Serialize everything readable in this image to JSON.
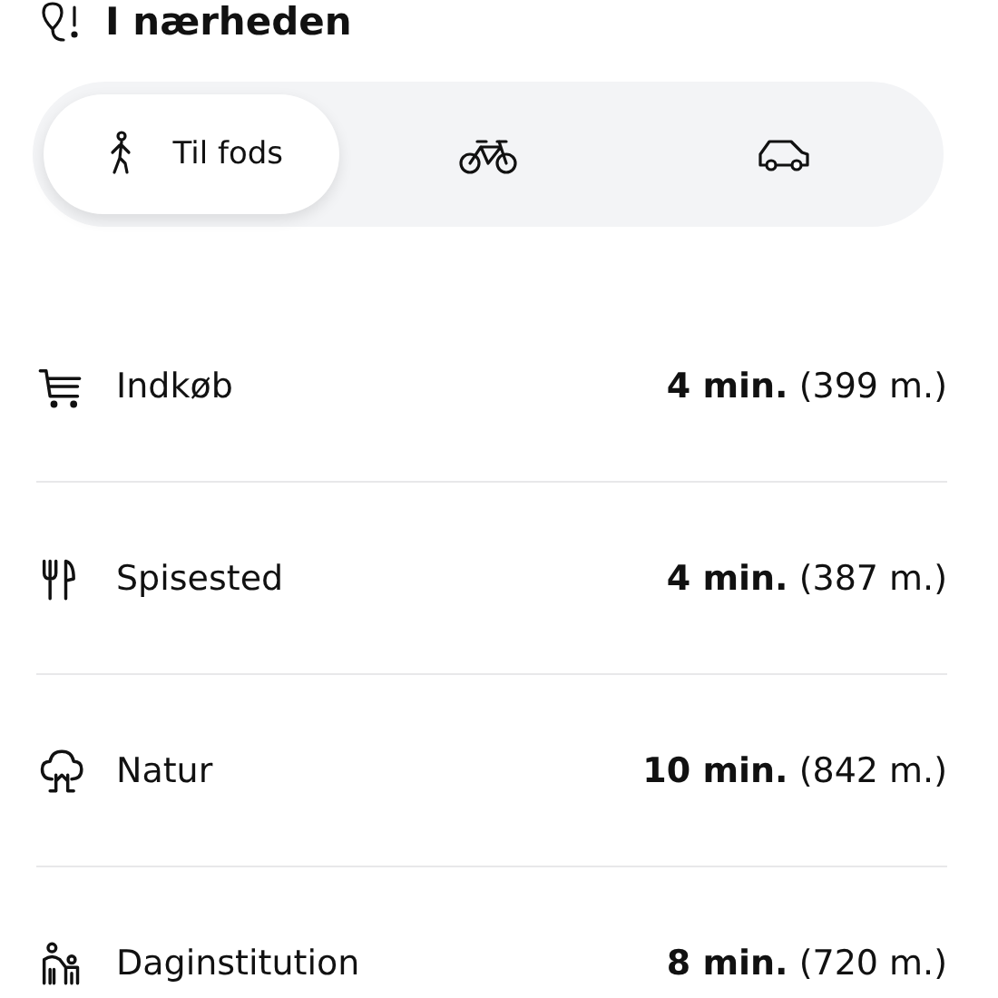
{
  "header": {
    "title": "I nærheden"
  },
  "modes": [
    {
      "kind": "walk",
      "label": "Til fods",
      "selected": true
    },
    {
      "kind": "bike",
      "selected": false
    },
    {
      "kind": "car",
      "selected": false
    }
  ],
  "places": [
    {
      "kind": "shopping",
      "name": "Indkøb",
      "time": "4 min.",
      "distance": "(399 m.)"
    },
    {
      "kind": "food",
      "name": "Spisested",
      "time": "4 min.",
      "distance": "(387 m.)"
    },
    {
      "kind": "nature",
      "name": "Natur",
      "time": "10 min.",
      "distance": "(842 m.)"
    },
    {
      "kind": "daycare",
      "name": "Daginstitution",
      "time": "8 min.",
      "distance": "(720 m.)"
    }
  ]
}
